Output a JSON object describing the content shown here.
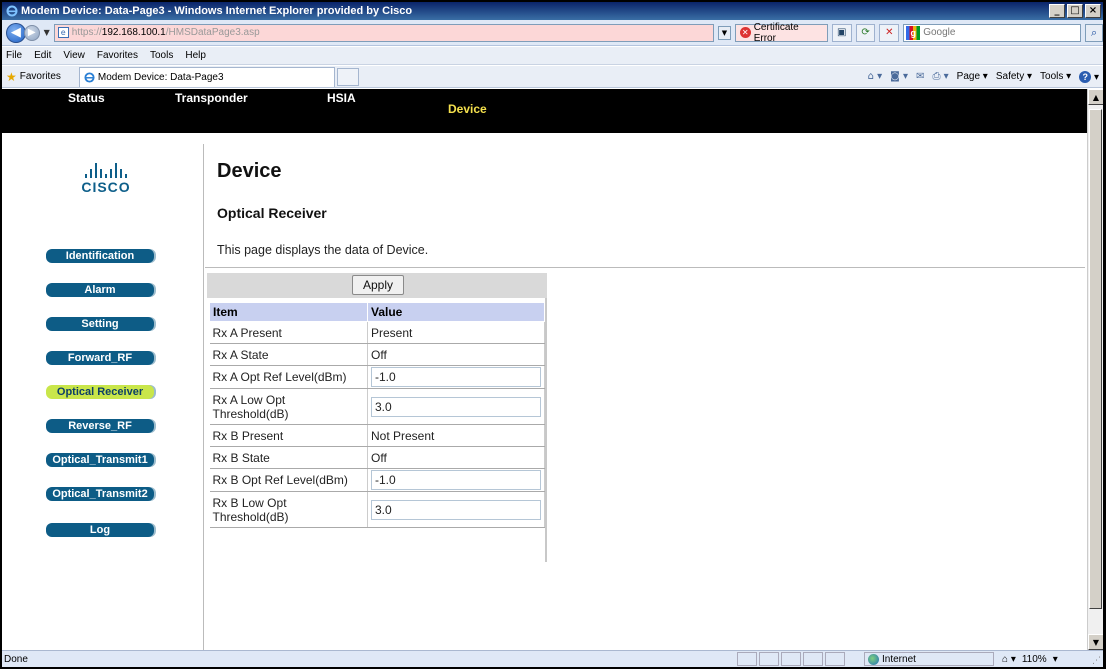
{
  "window": {
    "title": "Modem Device: Data-Page3 - Windows Internet Explorer provided by Cisco",
    "min": "_",
    "max": "□",
    "close": "×"
  },
  "address": {
    "url_proto": "https://",
    "url_host": "192.168.100.1",
    "url_path": "/HMSDataPage3.asp",
    "cert_error": "Certificate Error",
    "search_placeholder": "Google"
  },
  "menu": [
    "File",
    "Edit",
    "View",
    "Favorites",
    "Tools",
    "Help"
  ],
  "favorites": {
    "label": "Favorites",
    "tab_title": "Modem Device: Data-Page3",
    "cmd": {
      "page": "Page",
      "safety": "Safety",
      "tools": "Tools"
    }
  },
  "topnav": {
    "items": [
      "Status",
      "Transponder",
      "HSIA",
      "Device"
    ],
    "active": "Device"
  },
  "logo": {
    "text": "CISCO"
  },
  "sidebar": {
    "items": [
      {
        "label": "Identification"
      },
      {
        "label": "Alarm"
      },
      {
        "label": "Setting"
      },
      {
        "label": "Forward_RF"
      },
      {
        "label": "Optical Receiver"
      },
      {
        "label": "Reverse_RF"
      },
      {
        "label": "Optical_Transmit1"
      },
      {
        "label": "Optical_Transmit2"
      },
      {
        "label": "Log"
      }
    ],
    "active": "Optical Receiver"
  },
  "page": {
    "title": "Device",
    "subtitle": "Optical Receiver",
    "description": "This page displays the data of Device.",
    "apply_label": "Apply"
  },
  "table": {
    "headers": [
      "Item",
      "Value"
    ],
    "rows": [
      {
        "item": "Rx A Present",
        "value": "Present",
        "editable": false
      },
      {
        "item": "Rx A State",
        "value": "Off",
        "editable": false
      },
      {
        "item": "Rx A Opt Ref Level(dBm)",
        "value": "-1.0",
        "editable": true
      },
      {
        "item": "Rx A Low Opt Threshold(dB)",
        "value": "3.0",
        "editable": true
      },
      {
        "item": "Rx B Present",
        "value": "Not Present",
        "editable": false
      },
      {
        "item": "Rx B State",
        "value": "Off",
        "editable": false
      },
      {
        "item": "Rx B Opt Ref Level(dBm)",
        "value": "-1.0",
        "editable": true
      },
      {
        "item": "Rx B Low Opt Threshold(dB)",
        "value": "3.0",
        "editable": true
      }
    ]
  },
  "status": {
    "left": "Done",
    "zone": "Internet",
    "zoom": "110%"
  },
  "colors": {
    "nav_bg": "#000000",
    "nav_active": "#f4e04d",
    "sidebar_btn": "#0d5c86",
    "sidebar_active": "#c9e64a",
    "table_header": "#c8d0f0",
    "cisco_blue": "#0e5f8a"
  },
  "icons": {
    "back": "back-arrow-icon",
    "forward": "forward-arrow-icon",
    "refresh": "refresh-icon",
    "stop": "stop-icon",
    "search": "search-icon",
    "home": "home-icon",
    "feeds": "feeds-icon",
    "mail": "mail-icon",
    "print": "print-icon",
    "help": "help-icon",
    "favorites": "favorites-star-icon",
    "globe": "internet-zone-icon"
  }
}
